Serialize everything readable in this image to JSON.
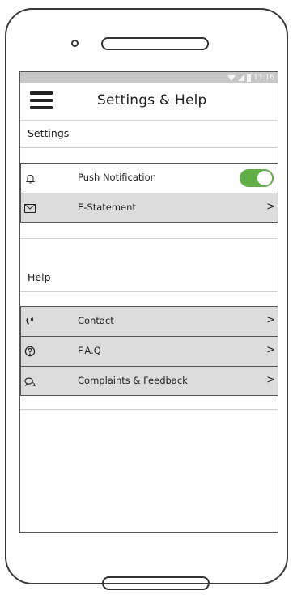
{
  "status_bar": {
    "time": "13:16"
  },
  "app_bar": {
    "title": "Settings & Help"
  },
  "settings": {
    "header": "Settings",
    "items": [
      {
        "label": "Push Notification",
        "icon": "bell-icon",
        "toggle_on": true
      },
      {
        "label": "E-Statement",
        "icon": "envelope-icon",
        "chevron": ">"
      }
    ]
  },
  "help": {
    "header": "Help",
    "items": [
      {
        "label": "Contact",
        "icon": "phone-icon",
        "chevron": ">"
      },
      {
        "label": "F.A.Q",
        "icon": "question-icon",
        "chevron": ">"
      },
      {
        "label": "Complaints & Feedback",
        "icon": "chat-icon",
        "chevron": ">"
      }
    ]
  },
  "colors": {
    "toggle_on": "#5fae47",
    "row_bg": "#dcdcdc",
    "status_bar": "#c7c7c7"
  }
}
